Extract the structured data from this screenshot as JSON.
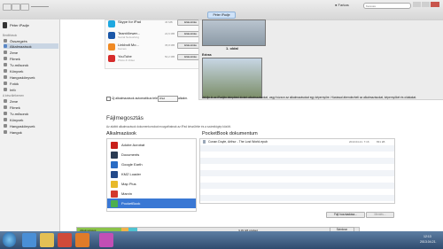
{
  "toolbar": {
    "device_badge": "Péter iPadje",
    "user_label": "Farkas",
    "search_placeholder": "Keresés"
  },
  "sidebar": {
    "device_name": "Péter iPadje",
    "section_library": "Beállítások",
    "items_top": [
      {
        "label": "Összegzés",
        "selected": false
      },
      {
        "label": "Alkalmazások",
        "selected": true
      }
    ],
    "items_lib": [
      "Zene",
      "Filmek",
      "Tv-műsorok",
      "Könyvek",
      "Hangoskönyvek",
      "Fotók",
      "Infó"
    ],
    "section_device": "A készülékemen",
    "items_dev": [
      "Zene",
      "Filmek",
      "Tv-műsorok",
      "Könyvek",
      "Hangoskönyvek",
      "Hangok"
    ]
  },
  "apps": [
    {
      "name": "Skype for iPad",
      "sub": "",
      "size": "46 MB",
      "action": "Eltávolítás",
      "color": "#1fa8e0"
    },
    {
      "name": "TeamViewer...",
      "sub": "Social Networking",
      "size": "22,6 MB",
      "action": "Eltávolítás",
      "color": "#1a57a8"
    },
    {
      "name": "Linkbolt Mo...",
      "sub": "Games",
      "size": "35,8 MB",
      "action": "Eltávolítás",
      "color": "#f08a24"
    },
    {
      "name": "YouTube",
      "sub": "Photo & Video",
      "size": "50,2 MB",
      "action": "Eltávolítás",
      "color": "#d62b2b"
    }
  ],
  "pages": {
    "header": "Péter iPadje",
    "page_label": "1. oldal",
    "extras_label": "Extras"
  },
  "auto_sync": {
    "checkbox_label": "Új alkalmazások automatikus telepítése",
    "select_value": "iPad",
    "after": "alkalm.",
    "help": "Jelölje ki az iPadjén telepíteni kívánt alkalmazásokat, vagy húzzon az alkalmazásokat egy képernyőre. Húzással átrendezheti az alkalmazásokat, képernyőket és oldalakat."
  },
  "file_sharing": {
    "title": "Fájlmegosztás",
    "desc": "Az alábbi alkalmazások dokumentumokat mozgathatnak az iPad készüléke és a számítógép között.",
    "apps_header": "Alkalmazások",
    "docs_header": "PocketBook dokumentum",
    "apps": [
      {
        "name": "Adobe Acrobat",
        "color": "#c8201b",
        "selected": false
      },
      {
        "name": "Documents",
        "color": "#2b3b52",
        "selected": false
      },
      {
        "name": "Google Earth",
        "color": "#2a6cc4",
        "selected": false
      },
      {
        "name": "KMZ Loader",
        "color": "#234a8a",
        "selected": false
      },
      {
        "name": "Map Plus",
        "color": "#e7b92a",
        "selected": false
      },
      {
        "name": "Marvin",
        "color": "#d2392d",
        "selected": false
      },
      {
        "name": "PocketBook",
        "color": "#4caf50",
        "selected": true
      }
    ],
    "doc": {
      "name": "Conan Doyle, Arthur - The Lost World.epub",
      "date": "2013.04.21. 7:16",
      "size": "831 kB"
    },
    "add_button": "Fájl hozzáadása...",
    "save_button": "Mentés..."
  },
  "capacity": {
    "apps_label": "Alkalmazások",
    "free_label": "9,39 GB szabad",
    "sync_button": "Szinkron"
  },
  "taskbar": {
    "time": "12:13",
    "date": "2013.04.21."
  }
}
